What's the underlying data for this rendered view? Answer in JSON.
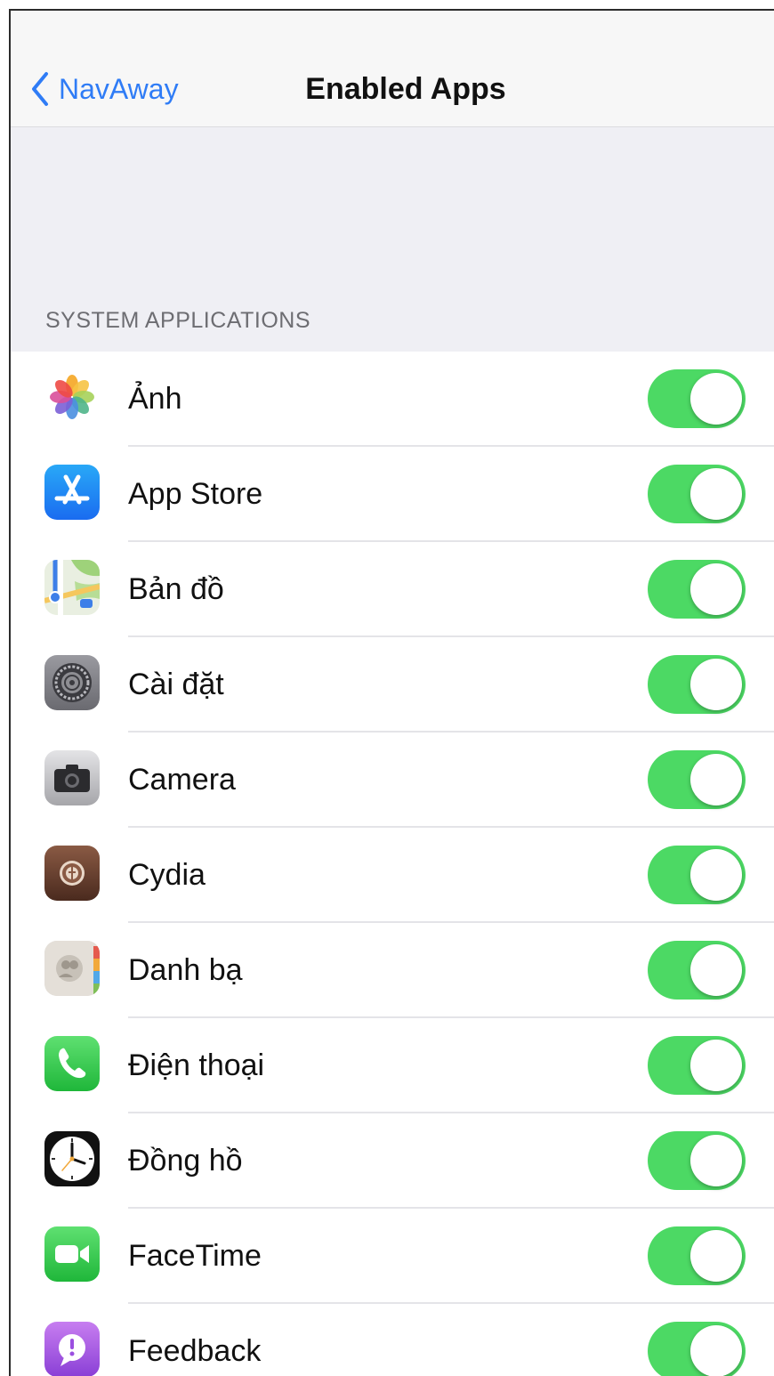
{
  "navbar": {
    "back_label": "NavAway",
    "title": "Enabled Apps"
  },
  "section": {
    "header": "SYSTEM APPLICATIONS"
  },
  "colors": {
    "accent": "#2f7cf6",
    "toggle_on": "#4cd964",
    "background": "#efeff4"
  },
  "apps": [
    {
      "label": "Ảnh",
      "icon": "photos-icon",
      "enabled": true
    },
    {
      "label": "App Store",
      "icon": "app-store-icon",
      "enabled": true
    },
    {
      "label": "Bản đồ",
      "icon": "maps-icon",
      "enabled": true
    },
    {
      "label": "Cài đặt",
      "icon": "settings-icon",
      "enabled": true
    },
    {
      "label": "Camera",
      "icon": "camera-icon",
      "enabled": true
    },
    {
      "label": "Cydia",
      "icon": "cydia-icon",
      "enabled": true
    },
    {
      "label": "Danh bạ",
      "icon": "contacts-icon",
      "enabled": true
    },
    {
      "label": "Điện thoại",
      "icon": "phone-icon",
      "enabled": true
    },
    {
      "label": "Đồng hồ",
      "icon": "clock-icon",
      "enabled": true
    },
    {
      "label": "FaceTime",
      "icon": "facetime-icon",
      "enabled": true
    },
    {
      "label": "Feedback",
      "icon": "feedback-icon",
      "enabled": true
    }
  ]
}
